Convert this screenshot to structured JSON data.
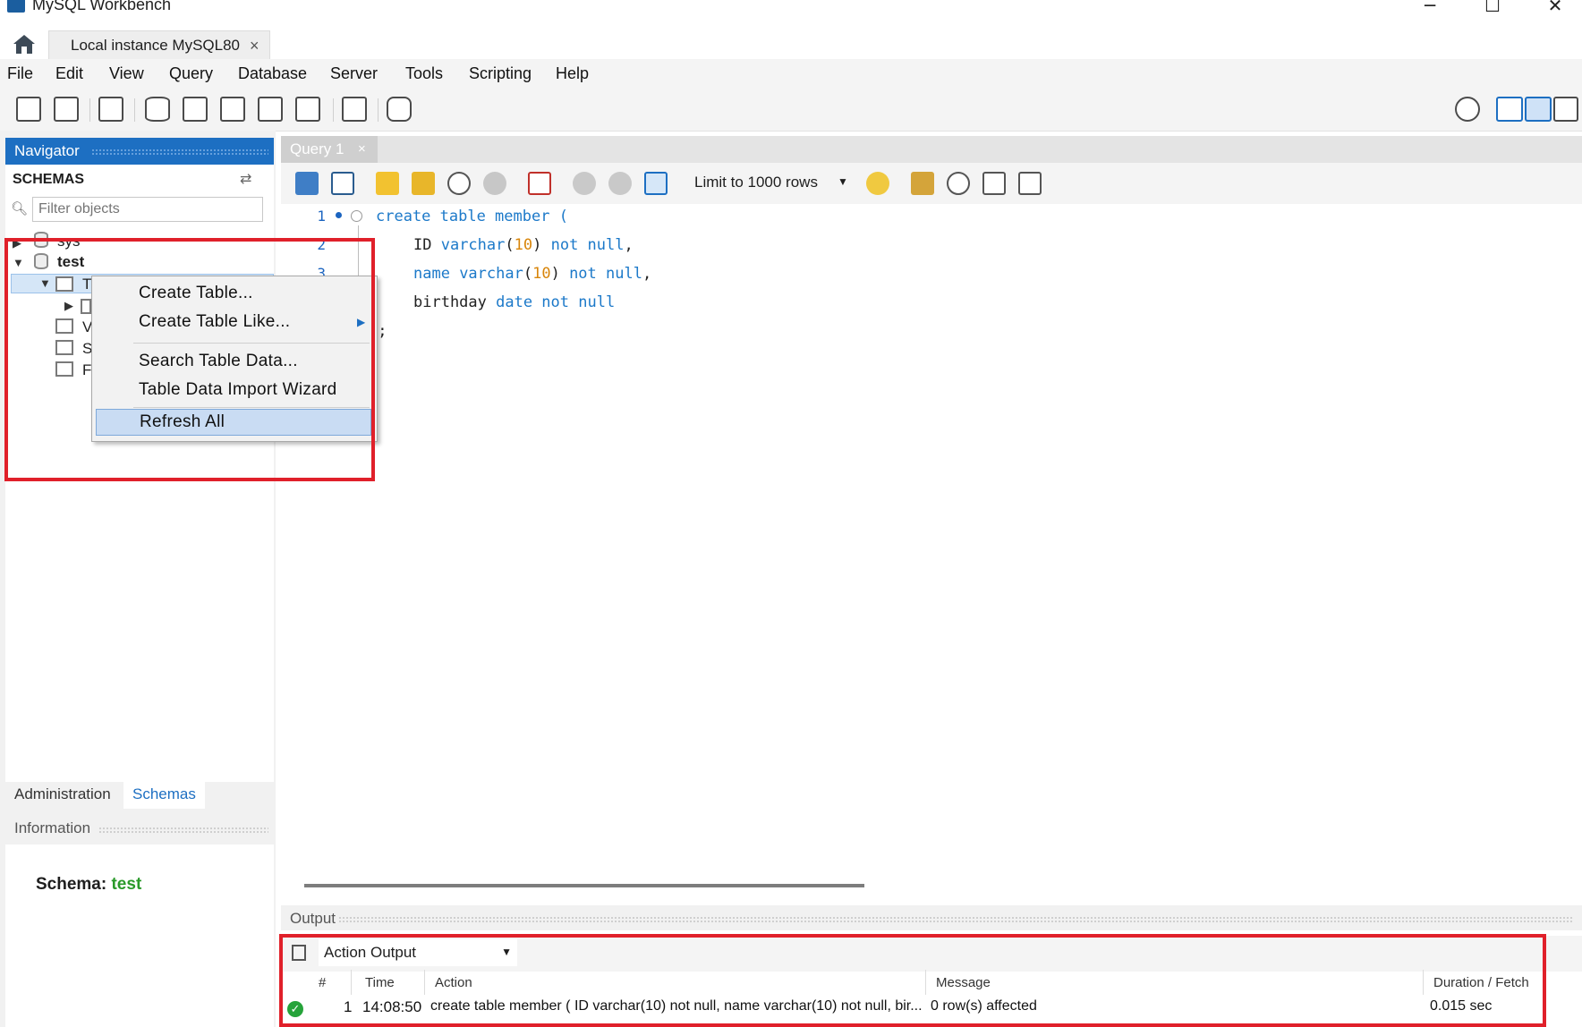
{
  "window": {
    "title": "MySQL Workbench",
    "min": "─",
    "max": "☐",
    "close": "✕"
  },
  "connection_tab": {
    "label": "Local instance MySQL80",
    "close": "×"
  },
  "menu": [
    "File",
    "Edit",
    "View",
    "Query",
    "Database",
    "Server",
    "Tools",
    "Scripting",
    "Help"
  ],
  "navigator": {
    "title": "Navigator",
    "schemas_label": "SCHEMAS",
    "filter_placeholder": "Filter objects",
    "tree": {
      "sys": "sys",
      "test": "test",
      "tables_partial": "T",
      "views_partial": "V",
      "procs_partial": "S",
      "funcs_partial": "F"
    }
  },
  "left_tabs": {
    "administration": "Administration",
    "schemas": "Schemas"
  },
  "information": {
    "title": "Information",
    "schema_label": "Schema:",
    "schema_value": "test"
  },
  "query_tab": {
    "label": "Query 1",
    "close": "×"
  },
  "limit_select": {
    "value": "Limit to 1000 rows"
  },
  "editor": {
    "line_numbers": [
      "1",
      "2",
      "3"
    ],
    "lines": [
      {
        "a": "create table member",
        "b": " ("
      },
      {
        "a": "ID ",
        "b": "varchar",
        "c": "(",
        "d": "10",
        "e": ") ",
        "f": "not null",
        "g": ","
      },
      {
        "a": "name ",
        "b": "varchar",
        "c": "(",
        "d": "10",
        "e": ") ",
        "f": "not null",
        "g": ","
      },
      {
        "a": "birthday ",
        "b": "date not null"
      },
      {
        "a": ");"
      }
    ]
  },
  "context_menu": {
    "items": [
      "Create Table...",
      "Create Table Like...",
      "Search Table Data...",
      "Table Data Import Wizard",
      "Refresh All"
    ]
  },
  "output": {
    "title": "Output",
    "selector": "Action Output",
    "columns": [
      "#",
      "Time",
      "Action",
      "Message",
      "Duration / Fetch"
    ],
    "rows": [
      {
        "num": "1",
        "time": "14:08:50",
        "action": "create table member ( ID varchar(10) not null, name varchar(10) not null, bir...",
        "message": "0 row(s) affected",
        "duration": "0.015 sec"
      }
    ]
  },
  "colors": {
    "accent": "#1d6fc2",
    "highlight": "#e0202a",
    "keyword": "#1c79c9",
    "number": "#d8850a",
    "success": "#26a33a"
  }
}
